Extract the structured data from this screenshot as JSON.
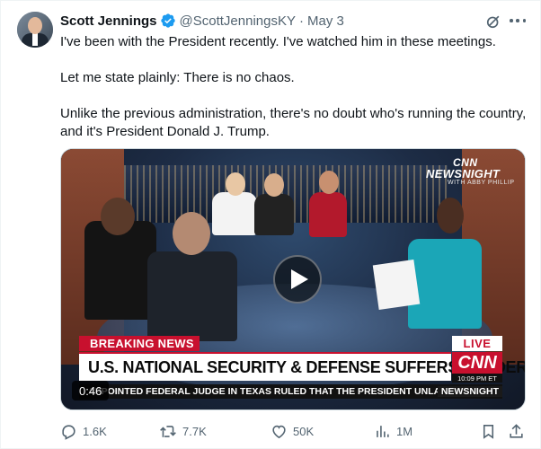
{
  "author": {
    "name": "Scott Jennings",
    "handle": "@ScottJenningsKY",
    "separator": "·",
    "date": "May 3",
    "verified_color": "#1d9bf0"
  },
  "tweet": {
    "paragraphs": [
      "I've been with the President recently. I've watched him in these meetings.",
      "Let me state plainly: There is no chaos.",
      "Unlike the previous administration, there's no doubt who's running the country, and it's President Donald J. Trump."
    ]
  },
  "video": {
    "duration": "0:46",
    "network_logo": "CNN",
    "show_name": "NEWSNIGHT",
    "show_host": "WITH ABBY PHILLIP",
    "breaking_label": "BREAKING NEWS",
    "live_label": "LIVE",
    "headline": "U.S. NATIONAL SECURITY & DEFENSE SUFFERS LEADERSHIP TURMOIL",
    "chyron_logo": "CNN",
    "clock": "10:09 PM ET",
    "ticker": "APPOINTED FEDERAL JUDGE IN TEXAS RULED THAT THE PRESIDENT UNLAWFU",
    "ticker_tag": "NEWSNIGHT",
    "brand_red": "#c8102e"
  },
  "actions": {
    "replies": "1.6K",
    "reposts": "7.7K",
    "likes": "50K",
    "views": "1M"
  },
  "icons": [
    "verified-badge-icon",
    "grok-icon",
    "more-icon",
    "play-icon",
    "reply-icon",
    "repost-icon",
    "like-icon",
    "views-icon",
    "bookmark-icon",
    "share-icon"
  ]
}
